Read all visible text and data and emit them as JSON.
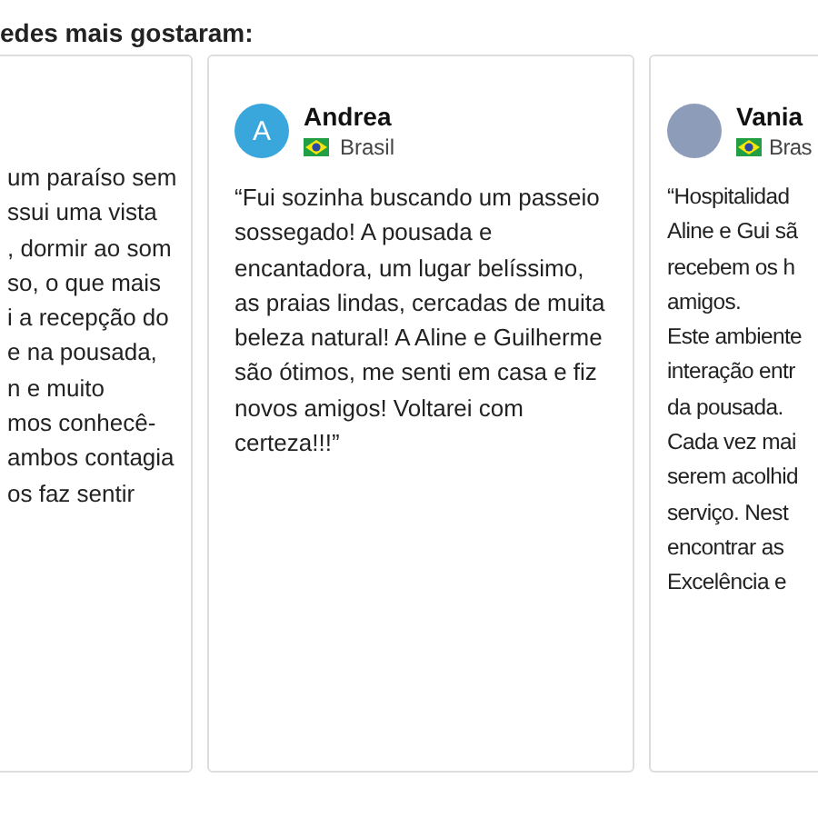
{
  "heading": "edes mais gostaram:",
  "reviews": [
    {
      "lines": [
        "um paraíso sem",
        "ssui uma vista",
        ", dormir ao som",
        "so, o que mais",
        "i a recepção do",
        "e na pousada,",
        "n e muito",
        "mos conhecê-",
        "ambos contagia",
        "os faz sentir"
      ]
    },
    {
      "author": "Andrea",
      "avatar": {
        "kind": "letter",
        "letter": "A"
      },
      "country": "Brasil",
      "lines": [
        "“Fui sozinha buscando um passeio",
        "sossegado! A pousada e",
        "encantadora, um lugar belíssimo,",
        "as praias lindas, cercadas de muita",
        "beleza natural! A Aline e Guilherme",
        "são ótimos, me senti em casa e fiz",
        "novos amigos! Voltarei com",
        "certeza!!!”"
      ]
    },
    {
      "author": "Vania",
      "avatar": {
        "kind": "photo"
      },
      "country": "Bras",
      "lines": [
        "“Hospitalidad",
        "Aline e Gui sã",
        "recebem os h",
        "amigos.",
        "Este ambiente",
        "interação entr",
        "da pousada.",
        "Cada vez mai",
        "serem acolhid",
        "serviço. Nest",
        "encontrar as",
        "Excelência e"
      ]
    }
  ]
}
